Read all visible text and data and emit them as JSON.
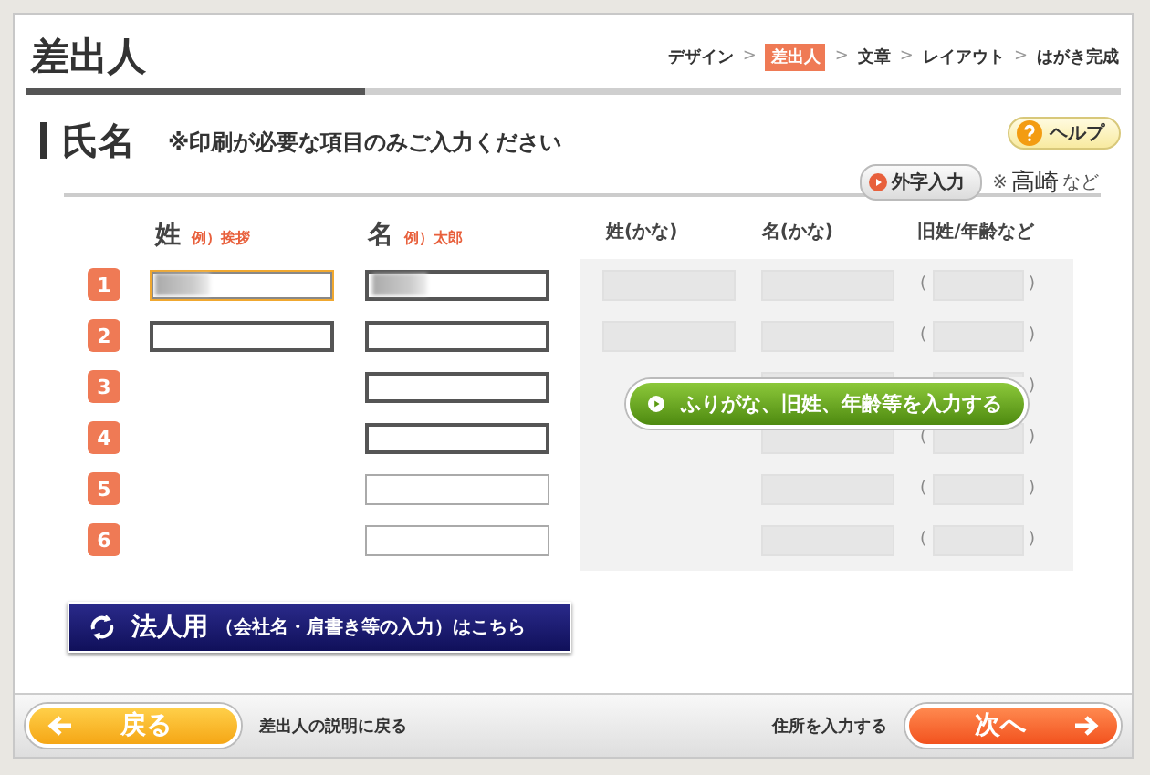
{
  "page_title": "差出人",
  "steps": [
    {
      "label": "デザイン",
      "selected": false
    },
    {
      "label": "差出人",
      "selected": true
    },
    {
      "label": "文章",
      "selected": false
    },
    {
      "label": "レイアウト",
      "selected": false
    },
    {
      "label": "はがき完成",
      "selected": false
    }
  ],
  "step_separator": ">",
  "progress": {
    "level": 0.31
  },
  "section": {
    "title": "氏名",
    "note": "※印刷が必要な項目のみご入力ください"
  },
  "help_button": "ヘルプ",
  "gaiji_button": "外字入力",
  "gaiji_example": {
    "mark": "※",
    "sample": "高崎",
    "suffix": "など"
  },
  "columns": [
    {
      "label": "姓",
      "example": "例）挨拶"
    },
    {
      "label": "名",
      "example": "例）太郎"
    }
  ],
  "kana_columns": [
    "姓(かな)",
    "名(かな)",
    "旧姓/年齢など"
  ],
  "paren_open": "(",
  "paren_close": ")",
  "rows": [
    {
      "number": "1",
      "sei": {
        "redacted": true,
        "focused": true
      },
      "mei": {
        "redacted": true,
        "focused": false,
        "disabled": false
      },
      "sei_kana": true
    },
    {
      "number": "2",
      "sei": {
        "redacted": false,
        "focused": false
      },
      "mei": {
        "redacted": false,
        "focused": false,
        "disabled": false
      },
      "sei_kana": true
    },
    {
      "number": "3",
      "mei": {
        "redacted": false,
        "focused": false,
        "disabled": false
      },
      "sei_kana": false
    },
    {
      "number": "4",
      "mei": {
        "redacted": false,
        "focused": false,
        "disabled": false
      },
      "sei_kana": false
    },
    {
      "number": "5",
      "mei": {
        "redacted": false,
        "focused": false,
        "disabled": true
      },
      "sei_kana": false
    },
    {
      "number": "6",
      "mei": {
        "redacted": false,
        "focused": false,
        "disabled": true
      },
      "sei_kana": false
    }
  ],
  "kana_button": "ふりがな、旧姓、年齢等を入力する",
  "corporate_button": {
    "main": "法人用",
    "sub": "（会社名・肩書き等の入力）はこちら"
  },
  "footer": {
    "back_button": "戻る",
    "back_note": "差出人の説明に戻る",
    "next_note": "住所を入力する",
    "next_button": "次へ"
  }
}
